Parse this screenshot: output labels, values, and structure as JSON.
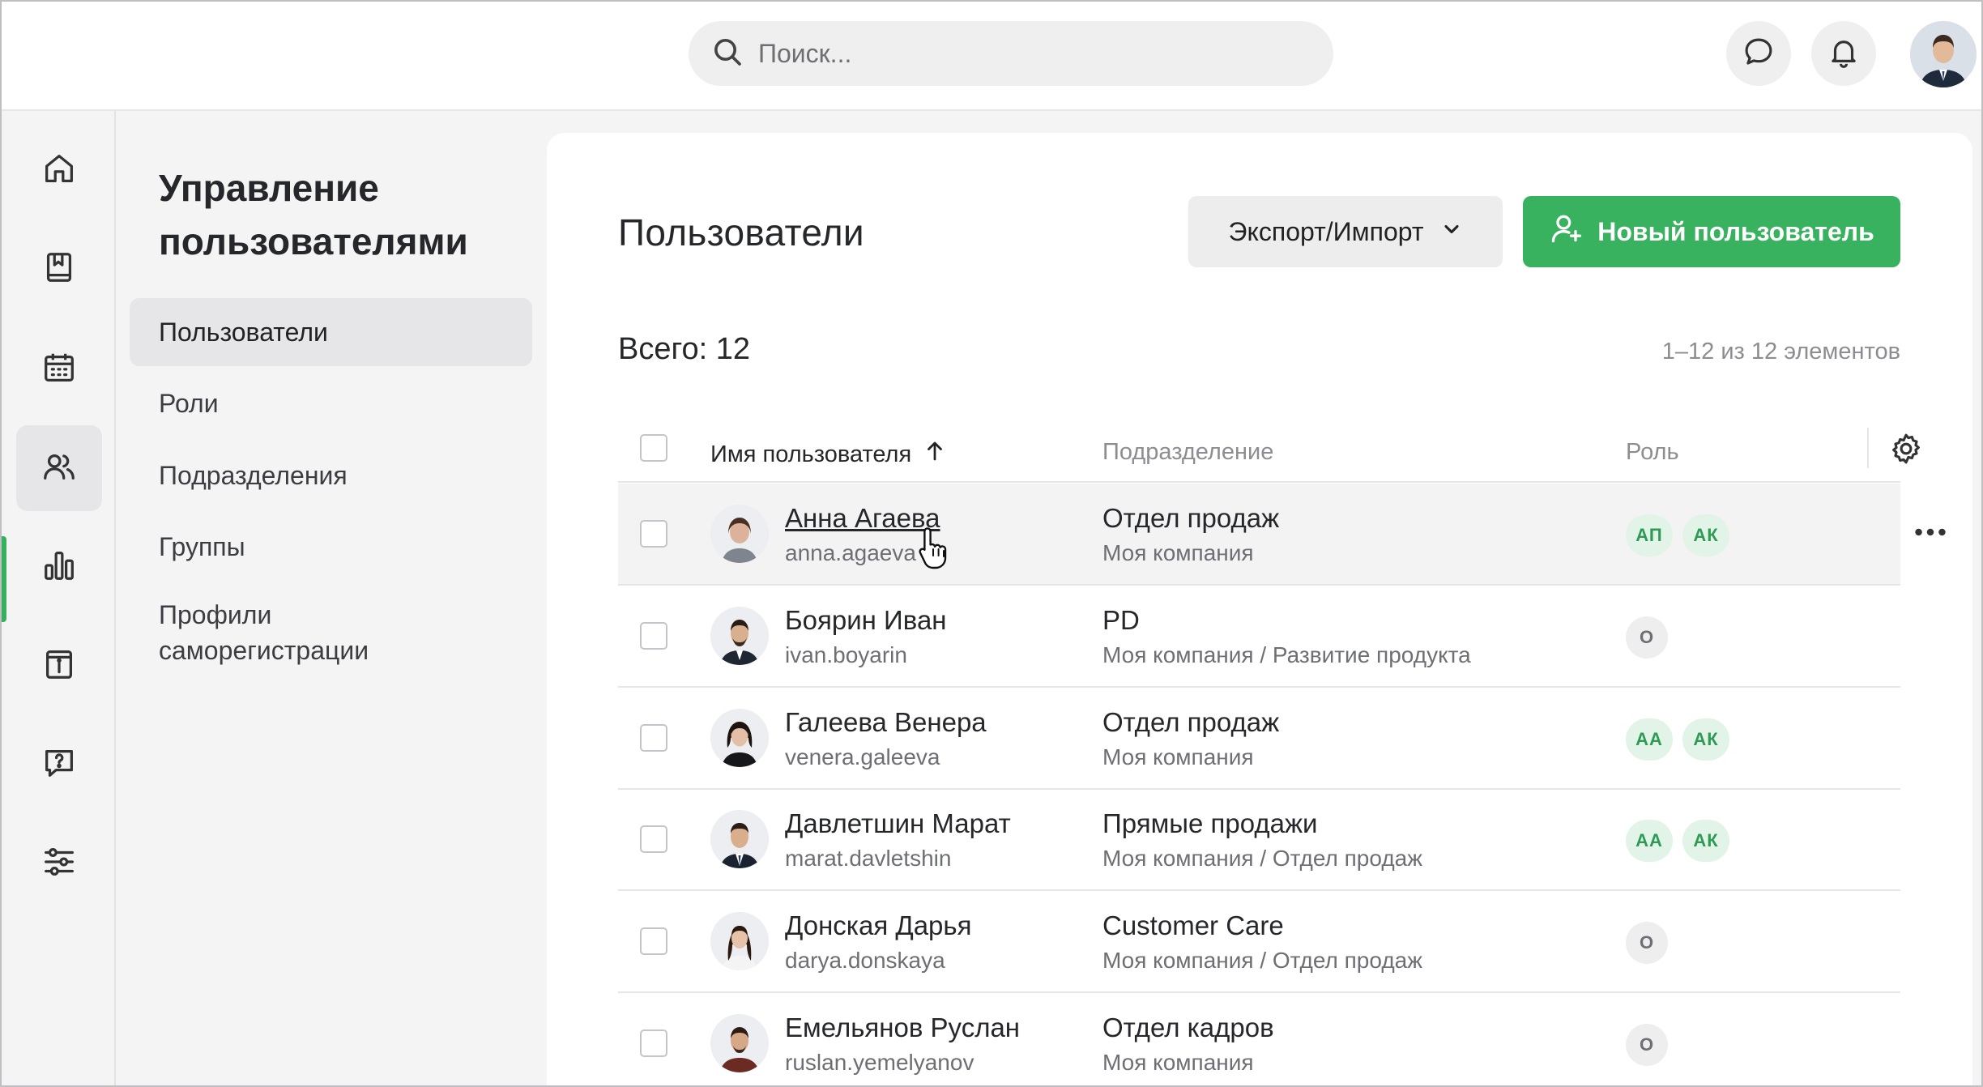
{
  "search": {
    "placeholder": "Поиск..."
  },
  "sidebar": {
    "title": "Управление пользователями",
    "items": [
      {
        "label": "Пользователи",
        "active": true
      },
      {
        "label": "Роли"
      },
      {
        "label": "Подразделения"
      },
      {
        "label": "Группы"
      },
      {
        "label": "Профили саморегистрации"
      }
    ]
  },
  "rail": {
    "icons": [
      "home-icon",
      "book-icon",
      "calendar-icon",
      "users-icon",
      "chart-icon",
      "info-icon",
      "help-icon",
      "settings-sliders-icon"
    ],
    "active": "users-icon",
    "accent": "#36b05c"
  },
  "main": {
    "title": "Пользователи",
    "export_label": "Экспорт/Импорт",
    "new_user_label": "Новый пользователь",
    "total": "Всего: 12",
    "range": "1–12 из 12 элементов",
    "columns": {
      "name": "Имя пользователя",
      "department": "Подразделение",
      "role": "Роль"
    },
    "accent": "#38b25e"
  },
  "users": [
    {
      "name": "Анна Агаева",
      "login": "anna.agaeva",
      "department": "Отдел продаж",
      "path": "Моя компания",
      "roles": [
        "АП",
        "АК"
      ],
      "role_color": "green"
    },
    {
      "name": "Боярин Иван",
      "login": "ivan.boyarin",
      "department": "PD",
      "path": "Моя компания / Развитие продукта",
      "roles": [
        "О"
      ],
      "role_color": "gray"
    },
    {
      "name": "Галеева Венера",
      "login": "venera.galeeva",
      "department": "Отдел продаж",
      "path": "Моя компания",
      "roles": [
        "АА",
        "АК"
      ],
      "role_color": "green"
    },
    {
      "name": "Давлетшин Марат",
      "login": "marat.davletshin",
      "department": "Прямые продажи",
      "path": "Моя компания / Отдел продаж",
      "roles": [
        "АА",
        "АК"
      ],
      "role_color": "green"
    },
    {
      "name": "Донская Дарья",
      "login": "darya.donskaya",
      "department": "Customer Care",
      "path": "Моя компания / Отдел продаж",
      "roles": [
        "О"
      ],
      "role_color": "gray"
    },
    {
      "name": "Емельянов Руслан",
      "login": "ruslan.yemelyanov",
      "department": "Отдел кадров",
      "path": "Моя компания",
      "roles": [
        "О"
      ],
      "role_color": "gray"
    }
  ]
}
